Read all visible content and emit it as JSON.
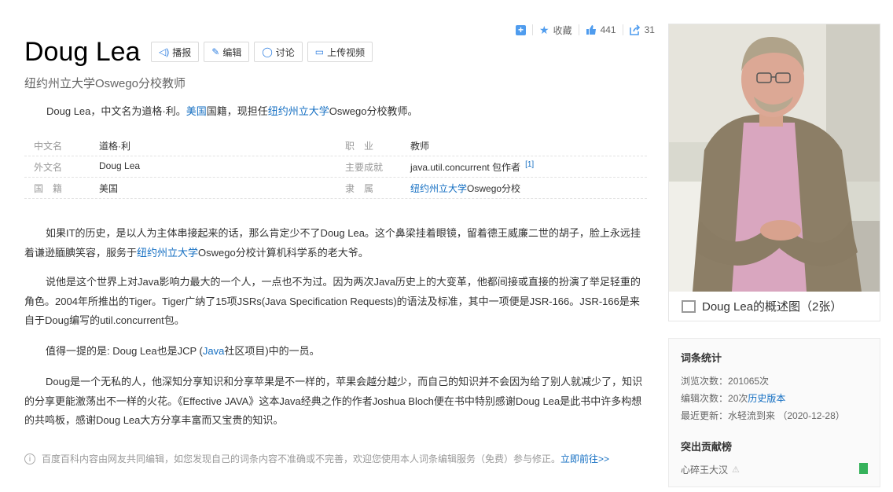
{
  "actions": {
    "favorite": "收藏",
    "likes": "441",
    "shares": "31"
  },
  "entry": {
    "title": "Doug Lea",
    "tools": [
      "播报",
      "编辑",
      "讨论",
      "上传视频"
    ],
    "subtitle": "纽约州立大学Oswego分校教师",
    "summary": {
      "prefix": "Doug Lea，中文名为道格·利。",
      "link1": "美国",
      "mid": "国籍，现担任",
      "link2": "纽约州立大学",
      "suffix": "Oswego分校教师。"
    }
  },
  "info": {
    "rows": [
      [
        {
          "k": "中文名",
          "v": "道格·利"
        },
        {
          "k": "职　业",
          "v": "教师"
        }
      ],
      [
        {
          "k": "外文名",
          "v": "Doug Lea"
        },
        {
          "k": "主要成就",
          "v": "java.util.concurrent 包作者",
          "ref": "[1]"
        }
      ],
      [
        {
          "k": "国　籍",
          "v": "美国",
          "link": true
        },
        {
          "k": "隶　属",
          "v": "纽约州立大学",
          "suffix": "Oswego分校",
          "link": true
        }
      ]
    ]
  },
  "paragraphs": {
    "p1a": "如果IT的历史，是以人为主体串接起来的话，那么肯定少不了Doug Lea。这个鼻梁挂着眼镜，留着德王威廉二世的胡子，脸上永远挂着谦逊腼腆笑容，服务于",
    "p1link": "纽约州立大学",
    "p1b": "Oswego分校计算机科学系的老大爷。",
    "p2": "说他是这个世界上对Java影响力最大的一个人，一点也不为过。因为两次Java历史上的大变革，他都间接或直接的扮演了举足轻重的角色。2004年所推出的Tiger。Tiger广纳了15项JSRs(Java Specification Requests)的语法及标准，其中一项便是JSR-166。JSR-166是来自于Doug编写的util.concurrent包。",
    "p3a": "值得一提的是: Doug Lea也是JCP (",
    "p3link": "Java",
    "p3b": "社区项目)中的一员。",
    "p4": "Doug是一个无私的人，他深知分享知识和分享苹果是不一样的，苹果会越分越少，而自己的知识并不会因为给了别人就减少了，知识的分享更能激荡出不一样的火花。《Effective JAVA》这本Java经典之作的作者Joshua Bloch便在书中特别感谢Doug Lea是此书中许多构想的共鸣板，感谢Doug Lea大方分享丰富而又宝贵的知识。"
  },
  "footer_note": {
    "text": "百度百科内容由网友共同编辑，如您发现自己的词条内容不准确或不完善，欢迎您使用本人词条编辑服务（免费）参与修正。",
    "link": "立即前往>>"
  },
  "photo": {
    "caption": "Doug Lea的概述图（2张）"
  },
  "stats": {
    "title": "词条统计",
    "views_label": "浏览次数：",
    "views": "201065次",
    "edits_label": "编辑次数：",
    "edits": "20次",
    "history_link": "历史版本",
    "updated_label": "最近更新：",
    "updated_by": "水轻流到来",
    "updated_date": "（2020-12-28）",
    "contrib_title": "突出贡献榜",
    "contributor": "心碎王大汉"
  },
  "colors": {
    "link": "#136ec2",
    "accent": "#4f9cee",
    "badge": "#36b25b"
  }
}
